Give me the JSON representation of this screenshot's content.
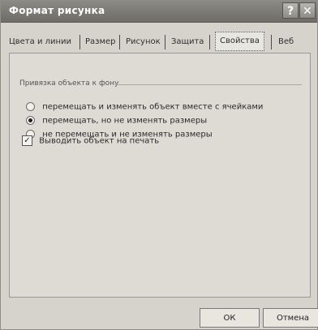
{
  "window": {
    "title": "Формат рисунка",
    "help_icon": "question-mark-icon",
    "close_icon": "close-icon"
  },
  "tabs": [
    {
      "label": "Цвета и линии"
    },
    {
      "label": "Размер"
    },
    {
      "label": "Рисунок"
    },
    {
      "label": "Защита"
    },
    {
      "label": "Свойства",
      "active": true
    },
    {
      "label": "Веб"
    }
  ],
  "panel": {
    "group_title": "Привязка объекта к фону",
    "options": [
      {
        "label": "перемещать и изменять объект вместе с ячейками",
        "selected": false
      },
      {
        "label": "перемещать, но не изменять размеры",
        "selected": true
      },
      {
        "label": "не перемещать и не изменять размеры",
        "selected": false
      }
    ],
    "print_checkbox": {
      "label": "Выводить объект на печать",
      "checked": true
    }
  },
  "buttons": {
    "ok": "ОК",
    "cancel": "Отмена"
  }
}
